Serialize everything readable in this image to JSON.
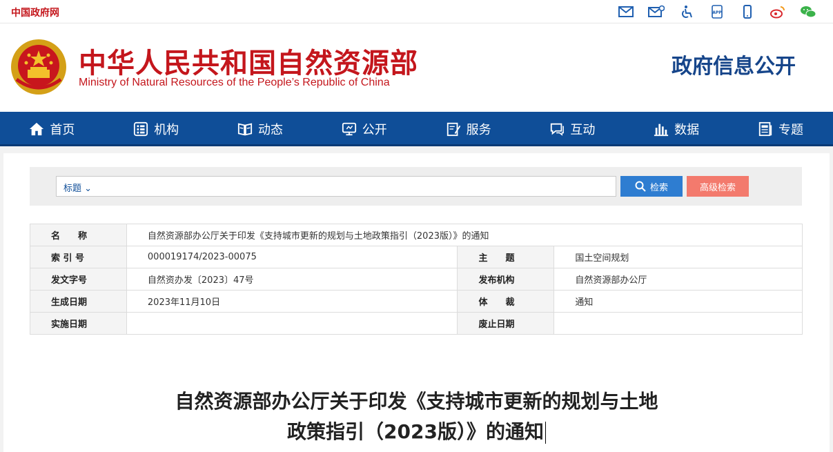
{
  "topbar": {
    "gov_link": "中国政府网",
    "icons": [
      "mail-icon",
      "mail-settings-icon",
      "accessibility-icon",
      "app-icon",
      "mobile-icon",
      "weibo-icon",
      "wechat-icon"
    ],
    "app_label": "APP"
  },
  "header": {
    "title_cn": "中华人民共和国自然资源部",
    "title_en": "Ministry of Natural Resources of the People’s Republic of China",
    "section": "政府信息公开"
  },
  "nav": {
    "items": [
      {
        "label": "首页",
        "icon": "home-icon"
      },
      {
        "label": "机构",
        "icon": "organization-icon"
      },
      {
        "label": "动态",
        "icon": "book-icon"
      },
      {
        "label": "公开",
        "icon": "monitor-icon"
      },
      {
        "label": "服务",
        "icon": "edit-icon"
      },
      {
        "label": "互动",
        "icon": "chat-icon"
      },
      {
        "label": "数据",
        "icon": "bar-chart-icon"
      },
      {
        "label": "专题",
        "icon": "document-icon"
      }
    ]
  },
  "search": {
    "scope": "标题",
    "placeholder": "",
    "search_label": "检索",
    "advanced_label": "高级检索"
  },
  "meta": {
    "name_label": "名　　称",
    "name_value": "自然资源部办公厅关于印发《支持城市更新的规划与土地政策指引（2023版）》的通知",
    "index_label": "索 引 号",
    "index_value": "000019174/2023-00075",
    "topic_label": "主　　题",
    "topic_value": "国土空间规划",
    "docno_label": "发文字号",
    "docno_value": "自然资办发〔2023〕47号",
    "issuer_label": "发布机构",
    "issuer_value": "自然资源部办公厅",
    "date_label": "生成日期",
    "date_value": "2023年11月10日",
    "genre_label": "体　　裁",
    "genre_value": "通知",
    "effective_label": "实施日期",
    "effective_value": "",
    "repeal_label": "废止日期",
    "repeal_value": ""
  },
  "document": {
    "title_line1": "自然资源部办公厅关于印发《支持城市更新的规划与土地",
    "title_line2": "政策指引（2023版）》的通知"
  },
  "colors": {
    "brand_red": "#c4161c",
    "nav_blue": "#0f4e98",
    "search_blue": "#2e7dd1",
    "advanced_salmon": "#f37a6d"
  }
}
